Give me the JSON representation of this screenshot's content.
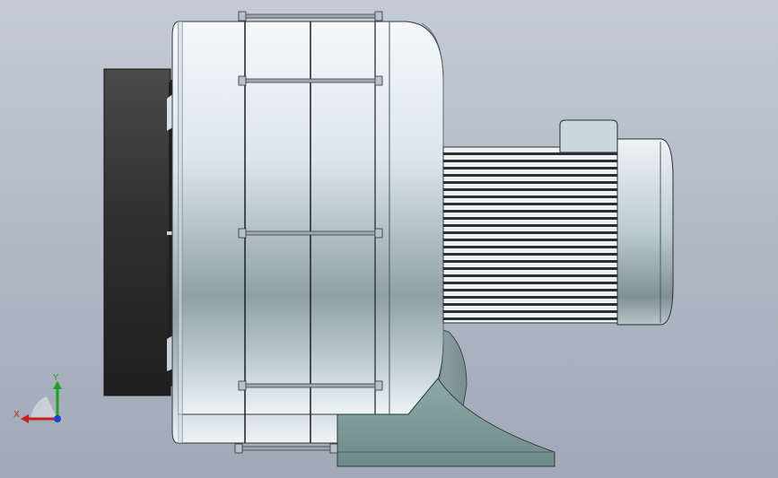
{
  "view": {
    "background_top": "#c4cbd6",
    "background_bottom": "#a0a9b7"
  },
  "model": {
    "part_colors": {
      "housing": "#c7d6dd",
      "dark_face": "#2e2e2e",
      "base": "#7f9b99",
      "motor_fins": "#e6eef0",
      "tie_rod": "#a3a9b3"
    }
  },
  "triad": {
    "x_label": "X",
    "y_label": "Y",
    "x_color": "#cc2020",
    "y_color": "#20a020",
    "z_color": "#2040d0"
  }
}
